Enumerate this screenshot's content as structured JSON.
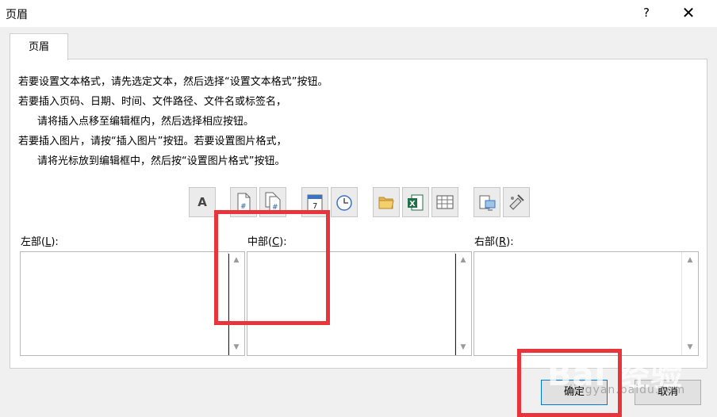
{
  "window": {
    "title": "页眉",
    "help": "?",
    "close": "✕"
  },
  "tab": {
    "label": "页眉"
  },
  "instructions": [
    "若要设置文本格式，请先选定文本，然后选择“设置文本格式”按钮。",
    "若要插入页码、日期、时间、文件路径、文件名或标签名，",
    "请将插入点移至编辑框内，然后选择相应按钮。",
    "若要插入图片，请按“插入图片”按钮。若要设置图片格式，",
    "请将光标放到编辑框中，然后按“设置图片格式”按钮。"
  ],
  "toolbar": {
    "format_text": "A",
    "page_number": "#",
    "page_count": "#",
    "date": "7",
    "time": "clock-icon",
    "file_path": "folder-icon",
    "file_name": "X",
    "sheet_name": "sheet-icon",
    "insert_picture": "picture-icon",
    "format_picture": "format-picture-icon"
  },
  "sections": {
    "left": {
      "label_pre": "左部(",
      "key": "L",
      "label_post": "):"
    },
    "center": {
      "label_pre": "中部(",
      "key": "C",
      "label_post": "):"
    },
    "right": {
      "label_pre": "右部(",
      "key": "R",
      "label_post": "):"
    }
  },
  "buttons": {
    "ok": "确定",
    "cancel": "取消"
  },
  "watermark": {
    "brand": "Bai 经验",
    "sub": "jingyan.baidu.com"
  },
  "colors": {
    "highlight": "#e8343b",
    "excel_green": "#1e7145"
  }
}
